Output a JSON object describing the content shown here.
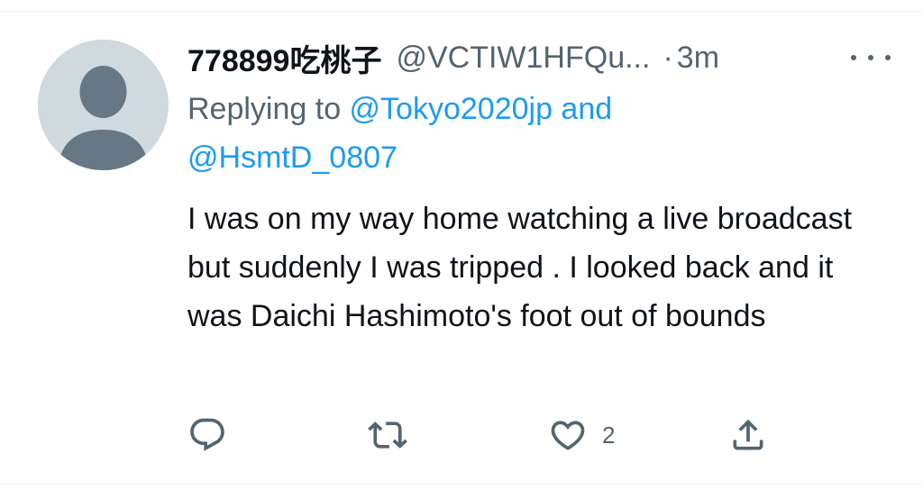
{
  "tweet": {
    "display_name": "778899吃桃子",
    "handle": "@VCTIW1HFQu...",
    "separator": "·",
    "time": "3m",
    "replying_prefix": "Replying to ",
    "reply_target_1": "@Tokyo2020jp",
    "reply_and": " and",
    "reply_target_2": "@HsmtD_0807",
    "text": "I was on my way home watching a live broadcast but suddenly I was tripped . I looked back and it was Daichi Hashimoto's foot out of bounds"
  },
  "actions": {
    "reply_icon": "reply-icon",
    "retweet_icon": "retweet-icon",
    "like_icon": "heart-icon",
    "like_count": "2",
    "share_icon": "share-icon"
  },
  "colors": {
    "link": "#1d9bf0",
    "secondary_text": "#536471",
    "primary_text": "#0f1419",
    "avatar_bg": "#cfd9de",
    "avatar_fg": "#667786"
  }
}
